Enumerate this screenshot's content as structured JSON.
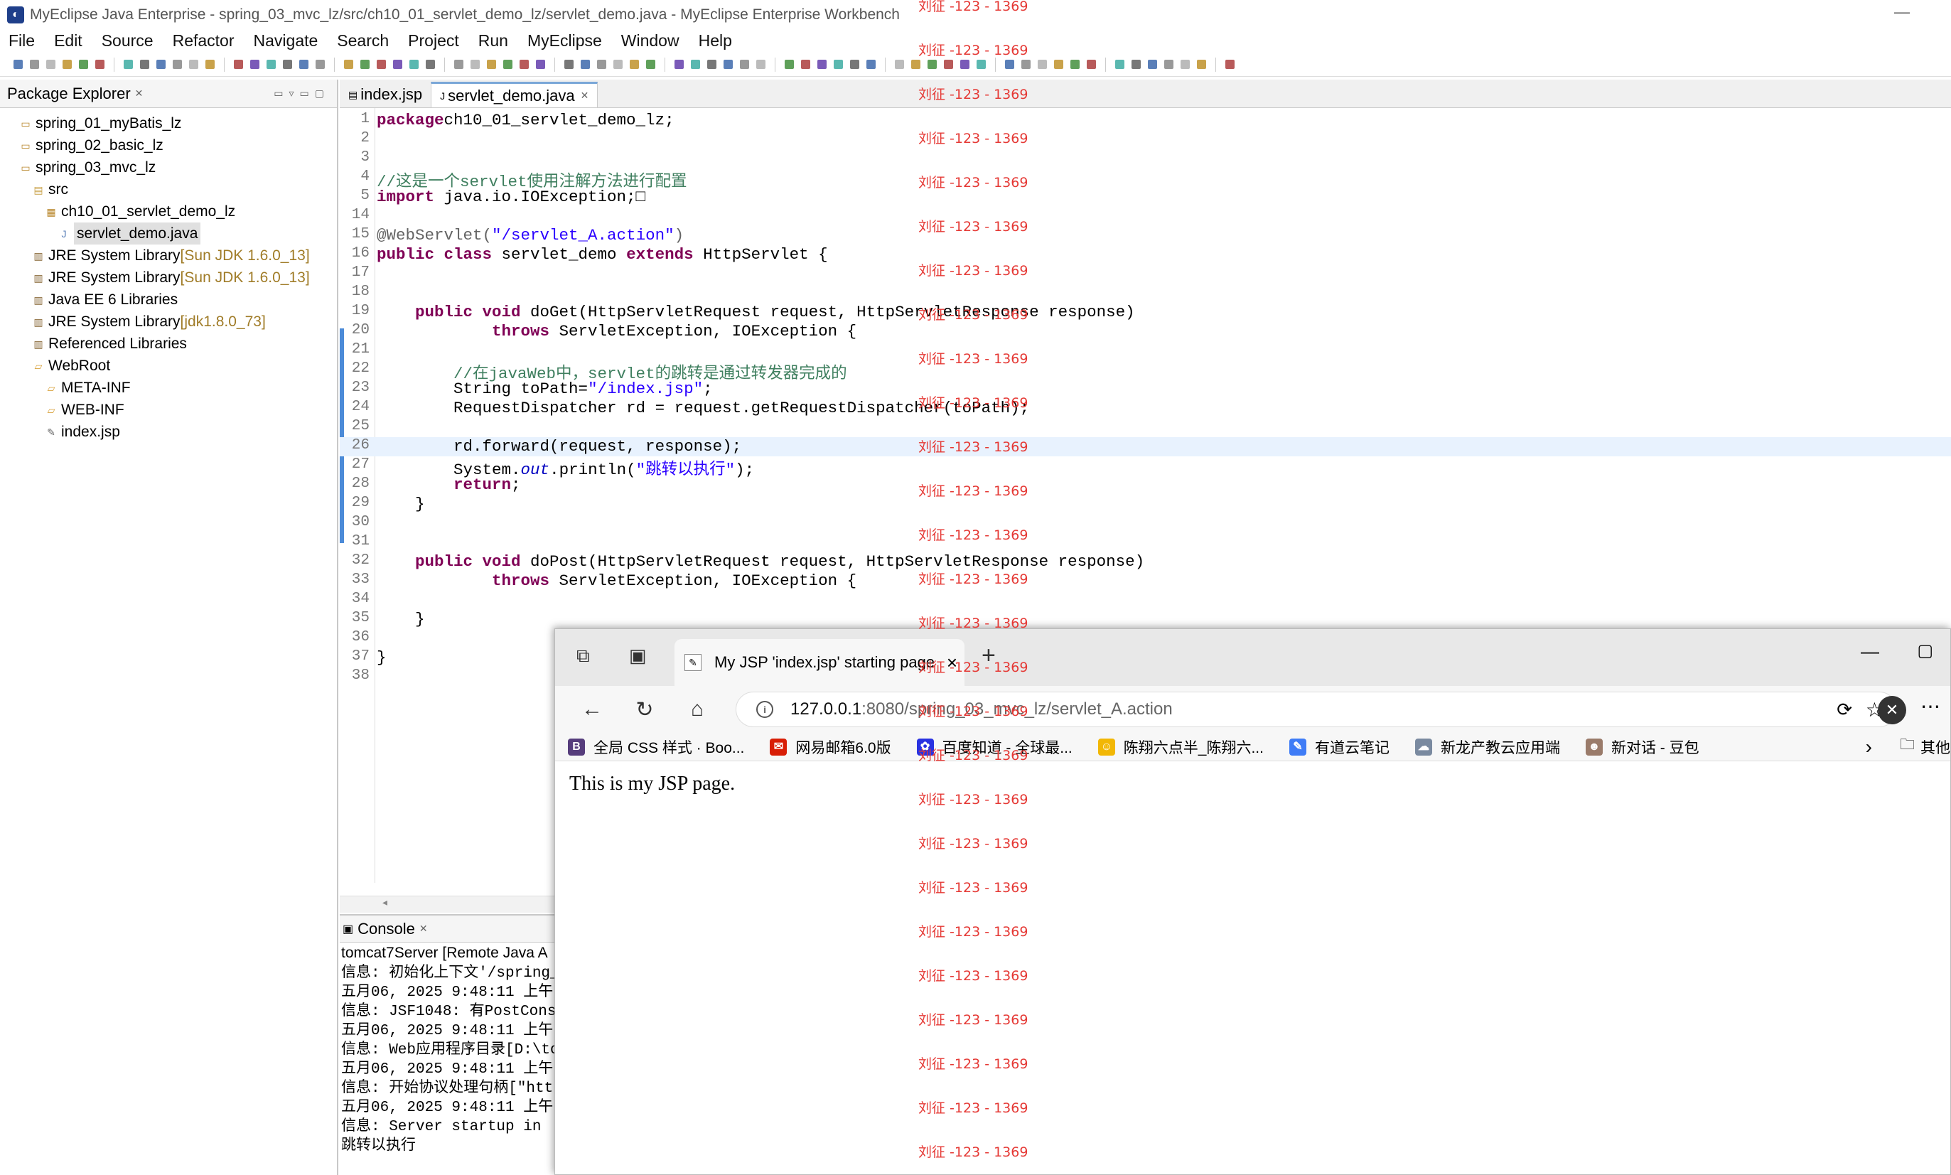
{
  "window": {
    "title": "MyEclipse Java Enterprise - spring_03_mvc_lz/src/ch10_01_servlet_demo_lz/servlet_demo.java - MyEclipse Enterprise Workbench",
    "minimize": "—"
  },
  "menu": [
    "File",
    "Edit",
    "Source",
    "Refactor",
    "Navigate",
    "Search",
    "Project",
    "Run",
    "MyEclipse",
    "Window",
    "Help"
  ],
  "package_explorer": {
    "title": "Package Explorer",
    "items": [
      {
        "label": "spring_01_myBatis_lz",
        "lib": ""
      },
      {
        "label": "spring_02_basic_lz",
        "lib": ""
      },
      {
        "label": "spring_03_mvc_lz",
        "lib": ""
      },
      {
        "label": "src",
        "lib": ""
      },
      {
        "label": "ch10_01_servlet_demo_lz",
        "lib": ""
      },
      {
        "label": "servlet_demo.java",
        "lib": ""
      },
      {
        "label": "JRE System Library ",
        "lib": "[Sun JDK 1.6.0_13]"
      },
      {
        "label": "JRE System Library ",
        "lib": "[Sun JDK 1.6.0_13]"
      },
      {
        "label": "Java EE 6 Libraries",
        "lib": ""
      },
      {
        "label": "JRE System Library ",
        "lib": "[jdk1.8.0_73]"
      },
      {
        "label": "Referenced Libraries",
        "lib": ""
      },
      {
        "label": "WebRoot",
        "lib": ""
      },
      {
        "label": "META-INF",
        "lib": ""
      },
      {
        "label": "WEB-INF",
        "lib": ""
      },
      {
        "label": "index.jsp",
        "lib": ""
      }
    ]
  },
  "editor": {
    "tabs": [
      "index.jsp",
      "servlet_demo.java"
    ],
    "lines": [
      {
        "n": "1",
        "parts": [
          [
            "kw",
            "package"
          ],
          [
            "",
            "ch10_01_servlet_demo_lz;"
          ]
        ]
      },
      {
        "n": "2",
        "parts": []
      },
      {
        "n": "3",
        "parts": []
      },
      {
        "n": "4",
        "parts": [
          [
            "cm",
            "//这是一个servlet使用注解方法进行配置"
          ]
        ]
      },
      {
        "n": "5",
        "parts": [
          [
            "kw",
            "import"
          ],
          [
            "",
            " java.io.IOException;□"
          ]
        ]
      },
      {
        "n": "14",
        "parts": []
      },
      {
        "n": "15",
        "parts": [
          [
            "ann",
            "@WebServlet("
          ],
          [
            "str",
            "\"/servlet_A.action\""
          ],
          [
            "ann",
            ")"
          ]
        ]
      },
      {
        "n": "16",
        "parts": [
          [
            "kw",
            "public class"
          ],
          [
            "",
            " servlet_demo "
          ],
          [
            "kw",
            "extends"
          ],
          [
            "",
            " HttpServlet {"
          ]
        ]
      },
      {
        "n": "17",
        "parts": []
      },
      {
        "n": "18",
        "parts": []
      },
      {
        "n": "19",
        "parts": [
          [
            "",
            "    "
          ],
          [
            "kw",
            "public void"
          ],
          [
            "",
            " doGet(HttpServletRequest request, HttpServletResponse response)"
          ]
        ]
      },
      {
        "n": "20",
        "parts": [
          [
            "",
            "            "
          ],
          [
            "kw",
            "throws"
          ],
          [
            "",
            " ServletException, IOException {"
          ]
        ]
      },
      {
        "n": "21",
        "parts": []
      },
      {
        "n": "22",
        "parts": [
          [
            "",
            "        "
          ],
          [
            "cm",
            "//在javaWeb中，servlet的跳转是通过转发器完成的"
          ]
        ]
      },
      {
        "n": "23",
        "parts": [
          [
            "",
            "        String toPath="
          ],
          [
            "str",
            "\"/index.jsp\""
          ],
          [
            "",
            ";"
          ]
        ]
      },
      {
        "n": "24",
        "parts": [
          [
            "",
            "        RequestDispatcher rd = request.getRequestDispatcher(toPath);"
          ]
        ]
      },
      {
        "n": "25",
        "parts": []
      },
      {
        "n": "26",
        "parts": [
          [
            "",
            "        rd.forward(request, response);"
          ]
        ]
      },
      {
        "n": "27",
        "parts": [
          [
            "",
            "        System."
          ],
          [
            "it",
            "out"
          ],
          [
            "",
            ".println("
          ],
          [
            "str",
            "\"跳转以执行\""
          ],
          [
            "",
            ");"
          ]
        ]
      },
      {
        "n": "28",
        "parts": [
          [
            "",
            "        "
          ],
          [
            "kw",
            "return"
          ],
          [
            "",
            ";"
          ]
        ]
      },
      {
        "n": "29",
        "parts": [
          [
            "",
            "    }"
          ]
        ]
      },
      {
        "n": "30",
        "parts": []
      },
      {
        "n": "31",
        "parts": []
      },
      {
        "n": "32",
        "parts": [
          [
            "",
            "    "
          ],
          [
            "kw",
            "public void"
          ],
          [
            "",
            " doPost(HttpServletRequest request, HttpServletResponse response)"
          ]
        ]
      },
      {
        "n": "33",
        "parts": [
          [
            "",
            "            "
          ],
          [
            "kw",
            "throws"
          ],
          [
            "",
            " ServletException, IOException {"
          ]
        ]
      },
      {
        "n": "34",
        "parts": []
      },
      {
        "n": "35",
        "parts": [
          [
            "",
            "    }"
          ]
        ]
      },
      {
        "n": "36",
        "parts": []
      },
      {
        "n": "37",
        "parts": [
          [
            "",
            "}"
          ]
        ]
      },
      {
        "n": "38",
        "parts": []
      }
    ]
  },
  "console": {
    "title": "Console",
    "server": "tomcat7Server [Remote Java A",
    "lines": [
      "信息: 初始化上下文'/spring_",
      "五月06, 2025 9:48:11 上午",
      "信息: JSF1048: 有PostCons",
      "五月06, 2025 9:48:11 上午",
      "信息: Web应用程序目录[D:\\tom",
      "五月06, 2025 9:48:11 上午",
      "信息: 开始协议处理句柄[\"http",
      "五月06, 2025 9:48:11 上午",
      "信息: Server startup in",
      "跳转以执行"
    ]
  },
  "browser": {
    "tab_title": "My JSP 'index.jsp' starting page",
    "url_host": "127.0.0.1",
    "url_rest": ":8080/spring_03_mvc_lz/servlet_A.action",
    "bookmarks": [
      {
        "label": "全局 CSS 样式 · Boo...",
        "color": "#563d7c",
        "glyph": "B"
      },
      {
        "label": "网易邮箱6.0版",
        "color": "#d81e06",
        "glyph": "✉"
      },
      {
        "label": "百度知道 - 全球最...",
        "color": "#2932e1",
        "glyph": "✿"
      },
      {
        "label": "陈翔六点半_陈翔六...",
        "color": "#f2b705",
        "glyph": "☺"
      },
      {
        "label": "有道云笔记",
        "color": "#3f7cf6",
        "glyph": "✎"
      },
      {
        "label": "新龙产教云应用端",
        "color": "#7a8aa0",
        "glyph": "☁"
      },
      {
        "label": "新对话 - 豆包",
        "color": "#9a7b6a",
        "glyph": "☻"
      }
    ],
    "other_folder": "其他",
    "page_text": "This is my JSP page."
  },
  "watermark": "刘征 -123 - 1369"
}
